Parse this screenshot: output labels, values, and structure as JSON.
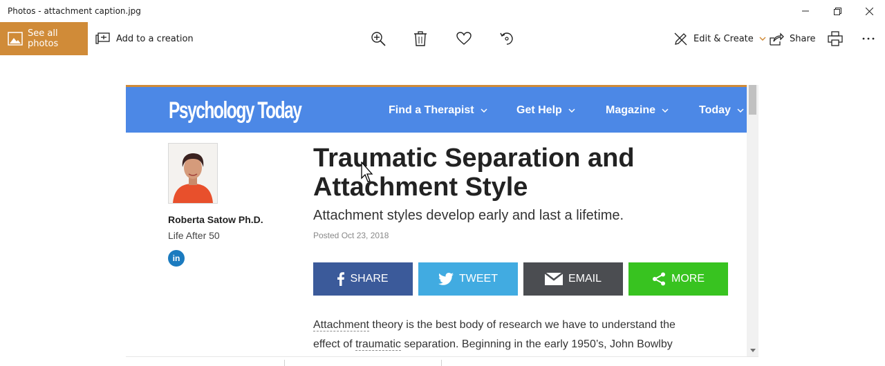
{
  "window": {
    "title": "Photos - attachment caption.jpg"
  },
  "toolbar": {
    "see_all_label": "See all photos",
    "add_creation_label": "Add to a creation",
    "edit_create_label": "Edit & Create",
    "share_label": "Share",
    "accent_color": "#d08b38"
  },
  "photo": {
    "site": {
      "logo": "Psychology Today",
      "header_color": "#4c88e6",
      "nav": [
        {
          "label": "Find a Therapist"
        },
        {
          "label": "Get Help"
        },
        {
          "label": "Magazine"
        },
        {
          "label": "Today"
        }
      ]
    },
    "author": {
      "name": "Roberta Satow Ph.D.",
      "blog": "Life After 50",
      "social": "in"
    },
    "article": {
      "headline": "Traumatic Separation and Attachment Style",
      "subhead": "Attachment styles develop early and last a lifetime.",
      "posted": "Posted Oct 23, 2018",
      "body_line1_link": "Attachment",
      "body_line1_rest": " theory is the best body of research we have to understand the",
      "body_line2_start": "effect of ",
      "body_line2_link": "traumatic",
      "body_line2_rest": " separation. Beginning in the early 1950’s, John Bowlby"
    },
    "share_buttons": [
      {
        "label": "SHARE",
        "color": "#3b5a9a"
      },
      {
        "label": "TWEET",
        "color": "#41abe1"
      },
      {
        "label": "EMAIL",
        "color": "#4b4d51"
      },
      {
        "label": "MORE",
        "color": "#38c320"
      }
    ]
  }
}
